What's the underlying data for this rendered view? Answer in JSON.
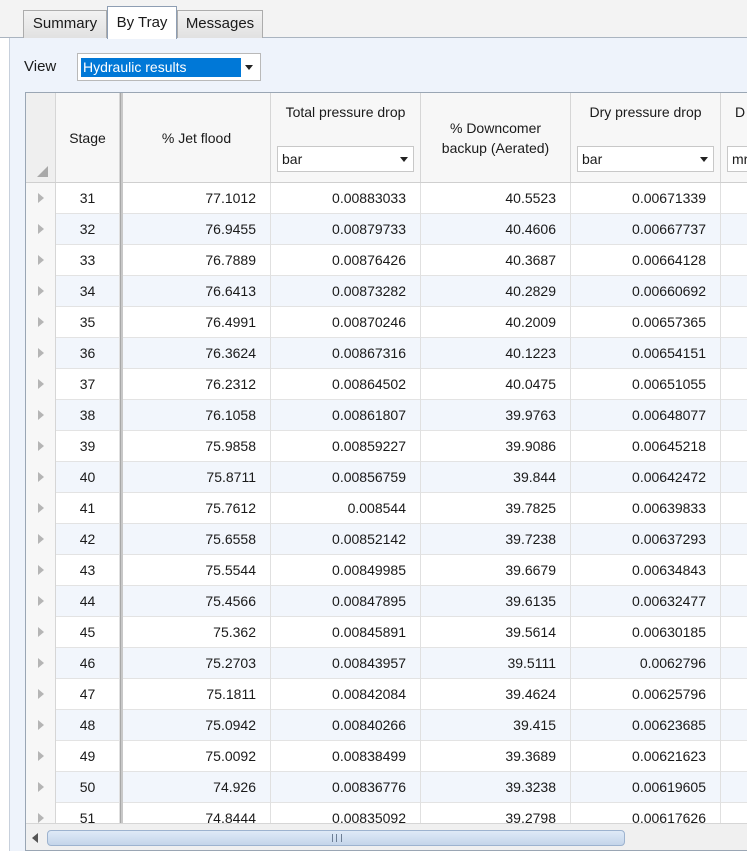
{
  "tabs": [
    {
      "label": "Summary"
    },
    {
      "label": "By Tray"
    },
    {
      "label": "Messages"
    }
  ],
  "view": {
    "label": "View",
    "value": "Hydraulic results"
  },
  "columns": {
    "stage": "Stage",
    "jet_flood": "% Jet flood",
    "total_dp": "Total pressure drop",
    "total_dp_unit": "bar",
    "downcomer_line1": "% Downcomer",
    "downcomer_line2": "backup (Aerated)",
    "dry_dp": "Dry pressure drop",
    "dry_dp_unit": "bar",
    "next_col_partial": "D",
    "next_col_unit_partial": "mr"
  },
  "rows": [
    {
      "stage": "31",
      "jet_flood": "77.1012",
      "total_dp": "0.00883033",
      "downcomer": "40.5523",
      "dry_dp": "0.00671339"
    },
    {
      "stage": "32",
      "jet_flood": "76.9455",
      "total_dp": "0.00879733",
      "downcomer": "40.4606",
      "dry_dp": "0.00667737"
    },
    {
      "stage": "33",
      "jet_flood": "76.7889",
      "total_dp": "0.00876426",
      "downcomer": "40.3687",
      "dry_dp": "0.00664128"
    },
    {
      "stage": "34",
      "jet_flood": "76.6413",
      "total_dp": "0.00873282",
      "downcomer": "40.2829",
      "dry_dp": "0.00660692"
    },
    {
      "stage": "35",
      "jet_flood": "76.4991",
      "total_dp": "0.00870246",
      "downcomer": "40.2009",
      "dry_dp": "0.00657365"
    },
    {
      "stage": "36",
      "jet_flood": "76.3624",
      "total_dp": "0.00867316",
      "downcomer": "40.1223",
      "dry_dp": "0.00654151"
    },
    {
      "stage": "37",
      "jet_flood": "76.2312",
      "total_dp": "0.00864502",
      "downcomer": "40.0475",
      "dry_dp": "0.00651055"
    },
    {
      "stage": "38",
      "jet_flood": "76.1058",
      "total_dp": "0.00861807",
      "downcomer": "39.9763",
      "dry_dp": "0.00648077"
    },
    {
      "stage": "39",
      "jet_flood": "75.9858",
      "total_dp": "0.00859227",
      "downcomer": "39.9086",
      "dry_dp": "0.00645218"
    },
    {
      "stage": "40",
      "jet_flood": "75.8711",
      "total_dp": "0.00856759",
      "downcomer": "39.844",
      "dry_dp": "0.00642472"
    },
    {
      "stage": "41",
      "jet_flood": "75.7612",
      "total_dp": "0.008544",
      "downcomer": "39.7825",
      "dry_dp": "0.00639833"
    },
    {
      "stage": "42",
      "jet_flood": "75.6558",
      "total_dp": "0.00852142",
      "downcomer": "39.7238",
      "dry_dp": "0.00637293"
    },
    {
      "stage": "43",
      "jet_flood": "75.5544",
      "total_dp": "0.00849985",
      "downcomer": "39.6679",
      "dry_dp": "0.00634843"
    },
    {
      "stage": "44",
      "jet_flood": "75.4566",
      "total_dp": "0.00847895",
      "downcomer": "39.6135",
      "dry_dp": "0.00632477"
    },
    {
      "stage": "45",
      "jet_flood": "75.362",
      "total_dp": "0.00845891",
      "downcomer": "39.5614",
      "dry_dp": "0.00630185"
    },
    {
      "stage": "46",
      "jet_flood": "75.2703",
      "total_dp": "0.00843957",
      "downcomer": "39.5111",
      "dry_dp": "0.0062796"
    },
    {
      "stage": "47",
      "jet_flood": "75.1811",
      "total_dp": "0.00842084",
      "downcomer": "39.4624",
      "dry_dp": "0.00625796"
    },
    {
      "stage": "48",
      "jet_flood": "75.0942",
      "total_dp": "0.00840266",
      "downcomer": "39.415",
      "dry_dp": "0.00623685"
    },
    {
      "stage": "49",
      "jet_flood": "75.0092",
      "total_dp": "0.00838499",
      "downcomer": "39.3689",
      "dry_dp": "0.00621623"
    },
    {
      "stage": "50",
      "jet_flood": "74.926",
      "total_dp": "0.00836776",
      "downcomer": "39.3238",
      "dry_dp": "0.00619605"
    },
    {
      "stage": "51",
      "jet_flood": "74.8444",
      "total_dp": "0.00835092",
      "downcomer": "39.2798",
      "dry_dp": "0.00617626"
    }
  ],
  "colors": {
    "selection": "#0078d7",
    "alt_row": "#f2f6fc",
    "panel": "#eef3fb"
  }
}
